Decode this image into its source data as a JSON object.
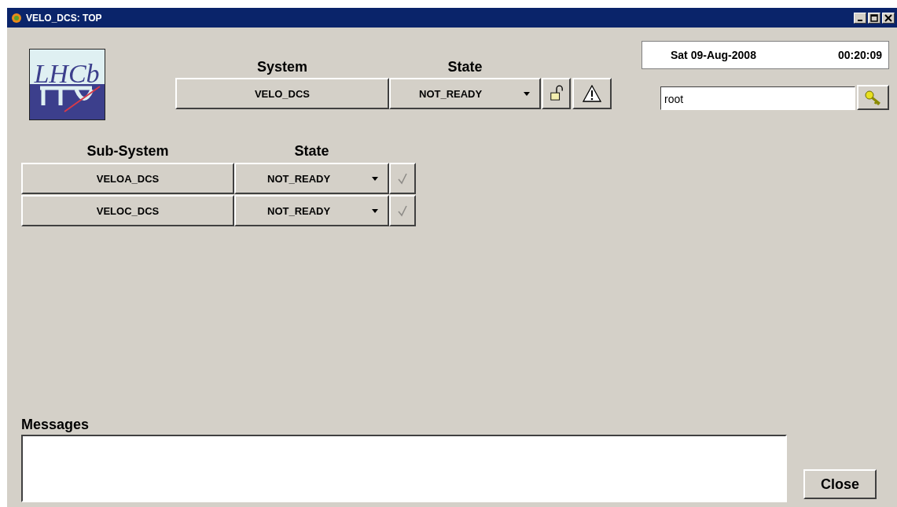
{
  "window": {
    "title": "VELO_DCS: TOP"
  },
  "logo": {
    "text": "LHCb"
  },
  "system": {
    "header_name": "System",
    "header_state": "State",
    "name": "VELO_DCS",
    "state": "NOT_READY",
    "locked": false
  },
  "clock": {
    "date": "Sat 09-Aug-2008",
    "time": "00:20:09"
  },
  "user": {
    "value": "root"
  },
  "subsystems": {
    "header_name": "Sub-System",
    "header_state": "State",
    "rows": [
      {
        "name": "VELOA_DCS",
        "state": "NOT_READY",
        "disabled": true
      },
      {
        "name": "VELOC_DCS",
        "state": "NOT_READY",
        "disabled": true
      }
    ]
  },
  "messages": {
    "label": "Messages"
  },
  "buttons": [
    "Close"
  ]
}
